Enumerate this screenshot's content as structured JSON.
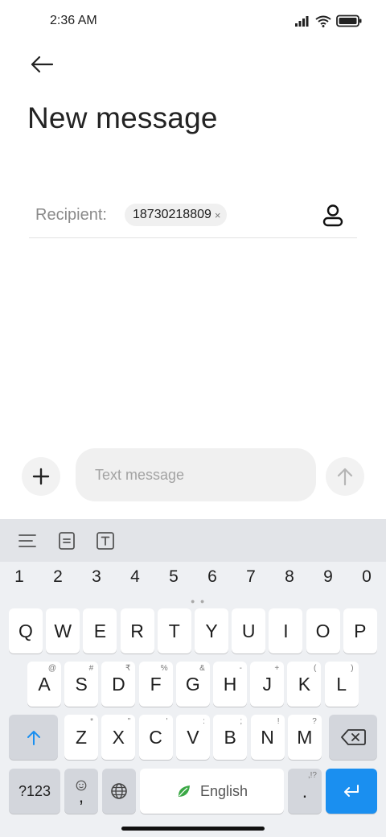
{
  "status": {
    "time": "2:36 AM"
  },
  "header": {
    "title": "New message"
  },
  "recipient": {
    "label": "Recipient:",
    "chip": "18730218809",
    "remove": "×"
  },
  "compose": {
    "placeholder": "Text message"
  },
  "keyboard": {
    "numbers": [
      "1",
      "2",
      "3",
      "4",
      "5",
      "6",
      "7",
      "8",
      "9",
      "0"
    ],
    "row1": [
      "Q",
      "W",
      "E",
      "R",
      "T",
      "Y",
      "U",
      "I",
      "O",
      "P"
    ],
    "row2": [
      {
        "k": "A",
        "h": "@"
      },
      {
        "k": "S",
        "h": "#"
      },
      {
        "k": "D",
        "h": "₹"
      },
      {
        "k": "F",
        "h": "%"
      },
      {
        "k": "G",
        "h": "&"
      },
      {
        "k": "H",
        "h": "-"
      },
      {
        "k": "J",
        "h": "+"
      },
      {
        "k": "K",
        "h": "("
      },
      {
        "k": "L",
        "h": ")"
      }
    ],
    "row3": [
      {
        "k": "Z",
        "h": "*"
      },
      {
        "k": "X",
        "h": "\""
      },
      {
        "k": "C",
        "h": "'"
      },
      {
        "k": "V",
        "h": ":"
      },
      {
        "k": "B",
        "h": ";"
      },
      {
        "k": "N",
        "h": "!"
      },
      {
        "k": "M",
        "h": "?"
      }
    ],
    "symbols_label": "?123",
    "comma": ",",
    "space_label": "English",
    "period": ".",
    "period_hint": ",!?"
  },
  "colors": {
    "accent": "#1a8ff0",
    "leaf": "#3aa845"
  }
}
